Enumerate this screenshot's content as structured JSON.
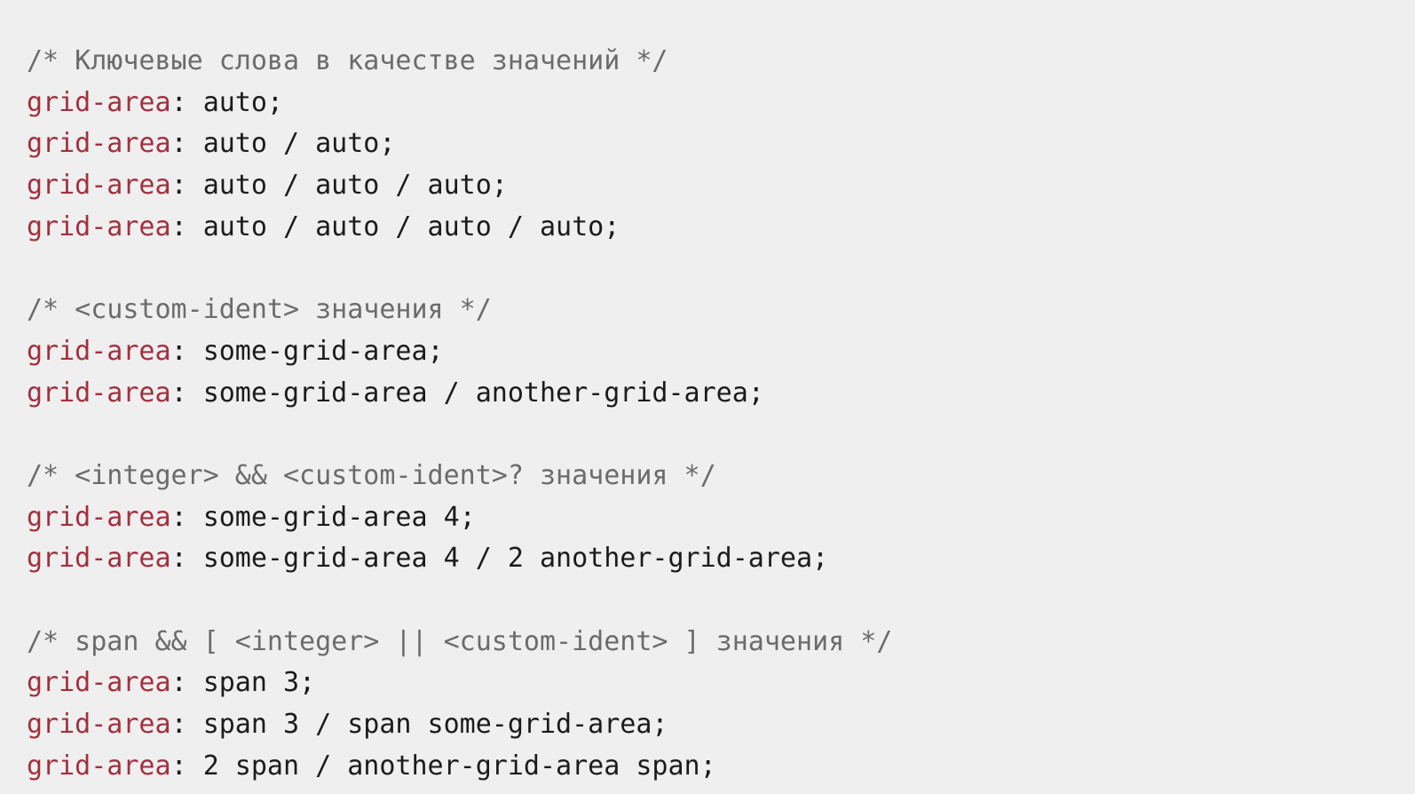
{
  "code": {
    "lines": [
      {
        "type": "comment",
        "text": "/* Ключевые слова в качестве значений */"
      },
      {
        "type": "decl",
        "prop": "grid-area",
        "sep": ": ",
        "value": "auto;"
      },
      {
        "type": "decl",
        "prop": "grid-area",
        "sep": ": ",
        "value": "auto / auto;"
      },
      {
        "type": "decl",
        "prop": "grid-area",
        "sep": ": ",
        "value": "auto / auto / auto;"
      },
      {
        "type": "decl",
        "prop": "grid-area",
        "sep": ": ",
        "value": "auto / auto / auto / auto;"
      },
      {
        "type": "blank"
      },
      {
        "type": "comment",
        "text": "/* <custom-ident> значения */"
      },
      {
        "type": "decl",
        "prop": "grid-area",
        "sep": ": ",
        "value": "some-grid-area;"
      },
      {
        "type": "decl",
        "prop": "grid-area",
        "sep": ": ",
        "value": "some-grid-area / another-grid-area;"
      },
      {
        "type": "blank"
      },
      {
        "type": "comment",
        "text": "/* <integer> && <custom-ident>? значения */"
      },
      {
        "type": "decl",
        "prop": "grid-area",
        "sep": ": ",
        "value": "some-grid-area 4;"
      },
      {
        "type": "decl",
        "prop": "grid-area",
        "sep": ": ",
        "value": "some-grid-area 4 / 2 another-grid-area;"
      },
      {
        "type": "blank"
      },
      {
        "type": "comment",
        "text": "/* span && [ <integer> || <custom-ident> ] значения */"
      },
      {
        "type": "decl",
        "prop": "grid-area",
        "sep": ": ",
        "value": "span 3;"
      },
      {
        "type": "decl",
        "prop": "grid-area",
        "sep": ": ",
        "value": "span 3 / span some-grid-area;"
      },
      {
        "type": "decl",
        "prop": "grid-area",
        "sep": ": ",
        "value": "2 span / another-grid-area span;"
      }
    ]
  },
  "colors": {
    "background": "#efefef",
    "comment": "#6b6b6b",
    "property": "#a3303f",
    "text": "#1b1b1b"
  }
}
